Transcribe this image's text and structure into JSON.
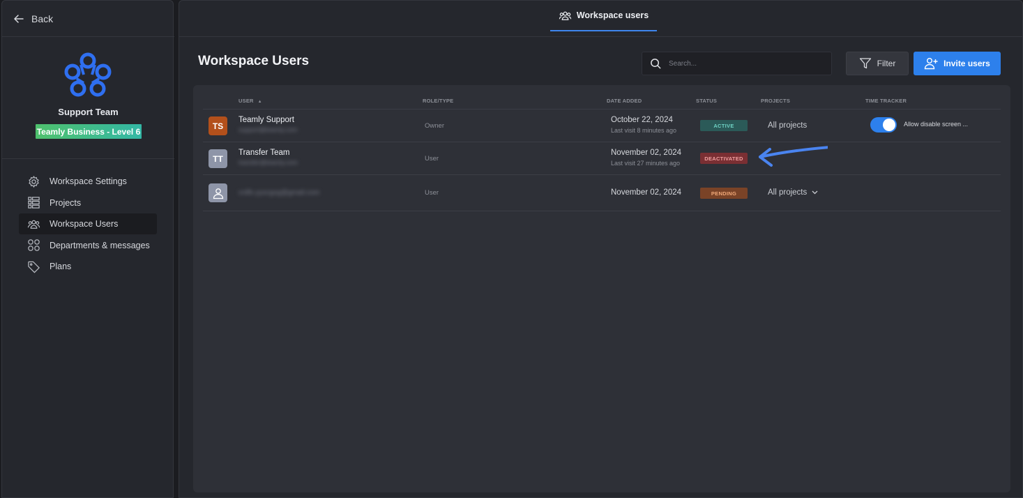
{
  "sidebar": {
    "back_label": "Back",
    "team_name": "Support Team",
    "plan_badge": "Teamly Business - Level 6",
    "items": [
      {
        "label": "Workspace Settings",
        "icon": "gear-icon"
      },
      {
        "label": "Projects",
        "icon": "projects-list-icon"
      },
      {
        "label": "Workspace Users",
        "icon": "users-icon",
        "active": true
      },
      {
        "label": "Departments & messages",
        "icon": "grid-icon"
      },
      {
        "label": "Plans",
        "icon": "tag-icon"
      }
    ]
  },
  "topbar": {
    "tab_label": "Workspace users"
  },
  "page": {
    "title": "Workspace Users",
    "search_placeholder": "Search...",
    "filter_label": "Filter",
    "invite_label": "Invite users"
  },
  "table": {
    "headers": {
      "user": "USER",
      "role": "ROLE/TYPE",
      "date": "DATE ADDED",
      "status": "STATUS",
      "projects": "PROJECTS",
      "time": "TIME TRACKER"
    },
    "rows": [
      {
        "initials": "TS",
        "avatar_color": "#b3501b",
        "name": "Teamly Support",
        "email": "support@teamly.com",
        "role": "Owner",
        "date": "October 22, 2024",
        "last_visit": "Last visit 8 minutes ago",
        "status": "ACTIVE",
        "status_bg": "#2b5a58",
        "status_fg": "#6fd2c4",
        "projects": "All projects",
        "toggle_label": "Allow disable screen ..."
      },
      {
        "initials": "TT",
        "avatar_color": "#8e95a8",
        "name": "Transfer Team",
        "email": "transfer@teamly.com",
        "role": "User",
        "date": "November 02, 2024",
        "last_visit": "Last visit 27 minutes ago",
        "status": "DEACTIVATED",
        "status_bg": "#7a2f33",
        "status_fg": "#f0a0a0"
      },
      {
        "avatar_color": "#8e95a8",
        "email": "crdfx.yyxcgvg@gmail.com",
        "role": "User",
        "date": "November 02, 2024",
        "status": "PENDING",
        "status_bg": "#7a4327",
        "status_fg": "#f1a979",
        "projects": "All projects"
      }
    ]
  },
  "colors": {
    "accent": "#2d80ec",
    "annotation_arrow": "#4a84f0"
  }
}
